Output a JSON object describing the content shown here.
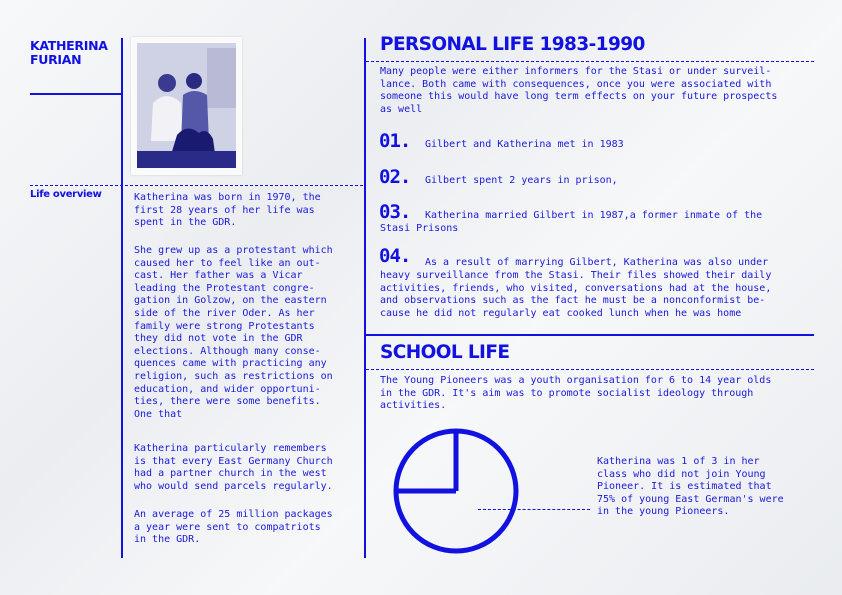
{
  "profile": {
    "name_line1": "KATHERINA",
    "name_line2": "FURIAN",
    "section_label": "Life overview"
  },
  "overview": {
    "para1": "Katherina was born in 1970, the\nfirst 28 years of her life was\nspent in the GDR.",
    "para2": "She grew up as a protestant which\ncaused her to feel like an out-\ncast. Her father was a Vicar\nleading the Protestant congre-\ngation in Golzow, on the eastern\nside of the river Oder. As her\nfamily were strong Protestants\nthey did not vote in the GDR\nelections. Although many conse-\nquences came with practicing any\nreligion, such as restrictions on\neducation, and wider opportuni-\nties, there were some benefits.\nOne that",
    "para3": "Katherina particularly remembers\nis that every East Germany Church\nhad a partner church in the west\nwho would send parcels regularly.",
    "para4": "An average of 25 million packages\na year were sent to compatriots\nin the GDR."
  },
  "personal_life": {
    "title": "PERSONAL LIFE 1983-1990",
    "intro": "Many people were either informers for the Stasi or under surveil-\nlance. Both came with consequences, once you were associated with\nsomeone this would have long term effects on your future prospects\nas well",
    "items": [
      {
        "number": "01.",
        "text": "Gilbert and Katherina met in 1983"
      },
      {
        "number": "02.",
        "text": "Gilbert spent 2 years in prison,"
      },
      {
        "number": "03.",
        "text": "Katherina married Gilbert in 1987,a former inmate of the",
        "text_cont": "Stasi Prisons"
      },
      {
        "number": "04.",
        "text": "As a result of marrying Gilbert, Katherina was also under",
        "text_cont": "heavy surveillance from the Stasi. Their files showed their daily\nactivities, friends, who visited, conversations had at the house,\nand observations such as the fact he must be a nonconformist be-\ncause he did not regularly eat cooked lunch when he was home"
      }
    ]
  },
  "school_life": {
    "title": "SCHOOL LIFE",
    "intro": "The Young Pioneers was a youth organisation for 6 to 14 year olds\nin the GDR. It's aim was to promote socialist ideology through\nactivities.",
    "caption": "Katherina was 1 of 3 in her\nclass who did not join Young\nPioneer. It is estimated that\n75% of young East German's were\nin the young Pioneers.",
    "pie_percent": 75
  },
  "colors": {
    "accent": "#1212e0",
    "background": "#eef0f3"
  }
}
